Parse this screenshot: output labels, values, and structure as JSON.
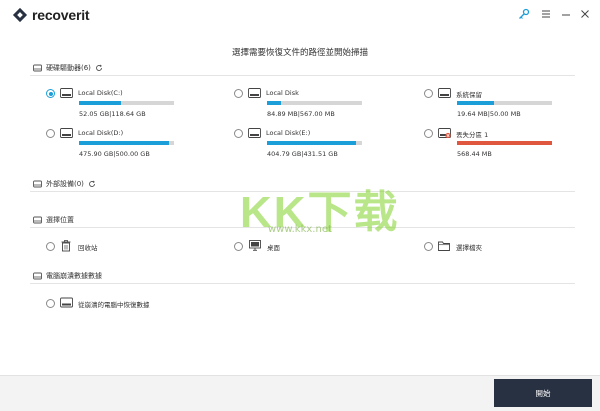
{
  "app": {
    "brand": "recoverit"
  },
  "headline": "選擇需要恢復文件的路徑並開始掃描",
  "sections": {
    "drives": "硬碟驅動器(6)",
    "external": "外部設備(0)",
    "location": "選擇位置",
    "crashed": "電腦崩潰數據數據"
  },
  "drives": [
    {
      "name": "Local Disk(C:)",
      "size": "52.05  GB|118.64  GB",
      "usage": 0.44,
      "color": "#1c9fd8",
      "selected": true
    },
    {
      "name": "Local Disk",
      "size": "84.89  MB|567.00  MB",
      "usage": 0.15,
      "color": "#1c9fd8",
      "selected": false
    },
    {
      "name": "系統保留",
      "size": "19.64  MB|50.00  MB",
      "usage": 0.39,
      "color": "#1c9fd8",
      "selected": false
    },
    {
      "name": "Local Disk(D:)",
      "size": "475.90  GB|500.00  GB",
      "usage": 0.95,
      "color": "#1c9fd8",
      "selected": false
    },
    {
      "name": "Local Disk(E:)",
      "size": "404.79  GB|431.51  GB",
      "usage": 0.94,
      "color": "#1c9fd8",
      "selected": false
    },
    {
      "name": "丟失分區 1",
      "size": "568.44  MB",
      "usage": 1.0,
      "color": "#e0573f",
      "selected": false
    }
  ],
  "locations": [
    {
      "name": "回收站",
      "icon": "recycle-bin-icon"
    },
    {
      "name": "桌面",
      "icon": "desktop-icon"
    },
    {
      "name": "選擇檔夾",
      "icon": "folder-icon"
    }
  ],
  "crashed_item": "從崩潰的電腦中恢復數據",
  "start_button": "開始",
  "watermark": "KK下载",
  "watermark_url": "www.kkx.net",
  "colors": {
    "accent": "#1c9fd8",
    "lost": "#e0573f",
    "button": "#283142"
  }
}
